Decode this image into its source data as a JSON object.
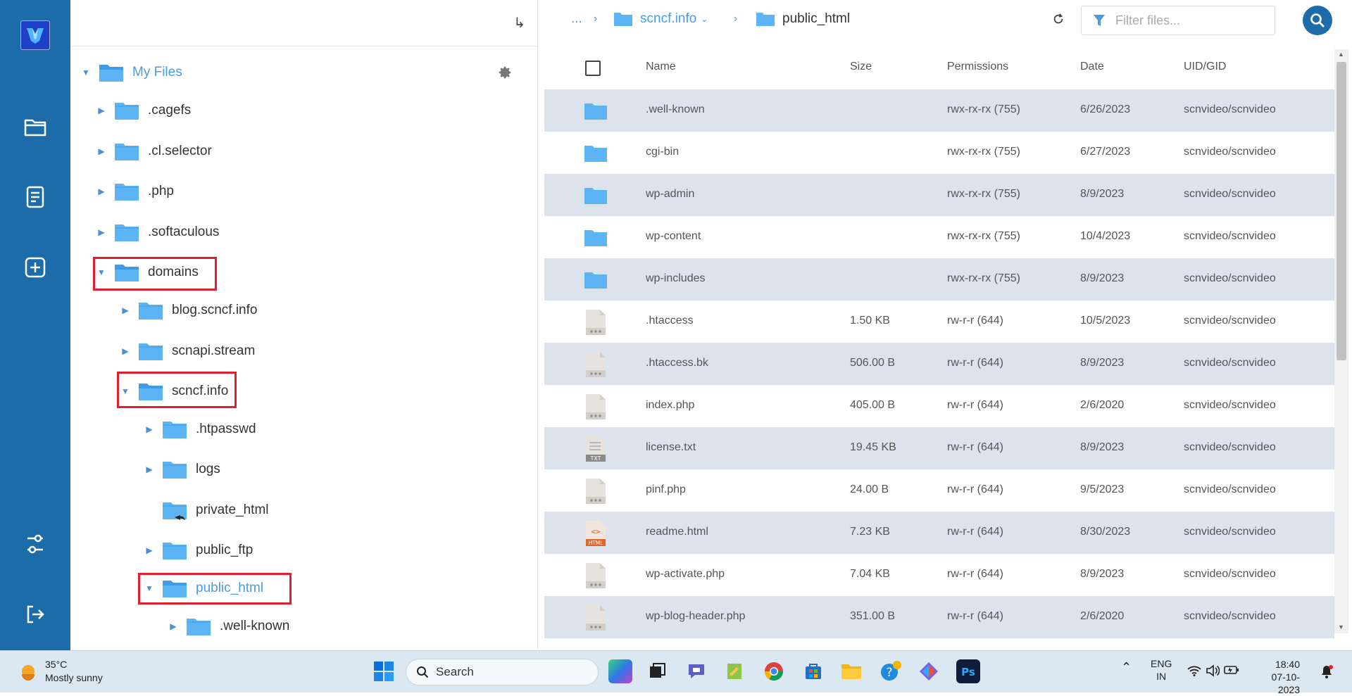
{
  "app": {
    "brand_color": "#1b6ca8",
    "highlight_color": "#e0202f"
  },
  "rail": {
    "items": [
      {
        "name": "files-icon"
      },
      {
        "name": "document-icon"
      },
      {
        "name": "add-icon"
      },
      {
        "name": "settings-sliders-icon"
      },
      {
        "name": "logout-icon"
      }
    ]
  },
  "tree": {
    "root_label": "My Files",
    "nodes": [
      {
        "label": ".cagefs"
      },
      {
        "label": ".cl.selector"
      },
      {
        "label": ".php"
      },
      {
        "label": ".softaculous"
      },
      {
        "label": "domains"
      },
      {
        "label": "blog.scncf.info"
      },
      {
        "label": "scnapi.stream"
      },
      {
        "label": "scncf.info"
      },
      {
        "label": ".htpasswd"
      },
      {
        "label": "logs"
      },
      {
        "label": "private_html"
      },
      {
        "label": "public_ftp"
      },
      {
        "label": "public_html"
      },
      {
        "label": ".well-known"
      }
    ]
  },
  "breadcrumb": {
    "ellipsis": "...",
    "domain": "scncf.info",
    "current": "public_html"
  },
  "filter": {
    "placeholder": "Filter files..."
  },
  "table": {
    "headers": {
      "name": "Name",
      "size": "Size",
      "permissions": "Permissions",
      "date": "Date",
      "uid": "UID/GID"
    },
    "rows": [
      {
        "type": "folder",
        "name": ".well-known",
        "size": "",
        "perm": "rwx-rx-rx (755)",
        "date": "6/26/2023",
        "uid": "scnvideo/scnvideo"
      },
      {
        "type": "folder",
        "name": "cgi-bin",
        "size": "",
        "perm": "rwx-rx-rx (755)",
        "date": "6/27/2023",
        "uid": "scnvideo/scnvideo"
      },
      {
        "type": "folder",
        "name": "wp-admin",
        "size": "",
        "perm": "rwx-rx-rx (755)",
        "date": "8/9/2023",
        "uid": "scnvideo/scnvideo"
      },
      {
        "type": "folder",
        "name": "wp-content",
        "size": "",
        "perm": "rwx-rx-rx (755)",
        "date": "10/4/2023",
        "uid": "scnvideo/scnvideo"
      },
      {
        "type": "folder",
        "name": "wp-includes",
        "size": "",
        "perm": "rwx-rx-rx (755)",
        "date": "8/9/2023",
        "uid": "scnvideo/scnvideo"
      },
      {
        "type": "file",
        "name": ".htaccess",
        "size": "1.50 KB",
        "perm": "rw-r-r (644)",
        "date": "10/5/2023",
        "uid": "scnvideo/scnvideo"
      },
      {
        "type": "file",
        "name": ".htaccess.bk",
        "size": "506.00 B",
        "perm": "rw-r-r (644)",
        "date": "8/9/2023",
        "uid": "scnvideo/scnvideo"
      },
      {
        "type": "file",
        "name": "index.php",
        "size": "405.00 B",
        "perm": "rw-r-r (644)",
        "date": "2/6/2020",
        "uid": "scnvideo/scnvideo"
      },
      {
        "type": "txt",
        "name": "license.txt",
        "size": "19.45 KB",
        "perm": "rw-r-r (644)",
        "date": "8/9/2023",
        "uid": "scnvideo/scnvideo"
      },
      {
        "type": "file",
        "name": "pinf.php",
        "size": "24.00 B",
        "perm": "rw-r-r (644)",
        "date": "9/5/2023",
        "uid": "scnvideo/scnvideo"
      },
      {
        "type": "html",
        "name": "readme.html",
        "size": "7.23 KB",
        "perm": "rw-r-r (644)",
        "date": "8/30/2023",
        "uid": "scnvideo/scnvideo"
      },
      {
        "type": "file",
        "name": "wp-activate.php",
        "size": "7.04 KB",
        "perm": "rw-r-r (644)",
        "date": "8/9/2023",
        "uid": "scnvideo/scnvideo"
      },
      {
        "type": "file",
        "name": "wp-blog-header.php",
        "size": "351.00 B",
        "perm": "rw-r-r (644)",
        "date": "2/6/2020",
        "uid": "scnvideo/scnvideo"
      }
    ]
  },
  "taskbar": {
    "temp": "35°C",
    "condition": "Mostly sunny",
    "search_label": "Search",
    "lang1": "ENG",
    "lang2": "IN",
    "time": "18:40",
    "date": "07-10-2023"
  }
}
